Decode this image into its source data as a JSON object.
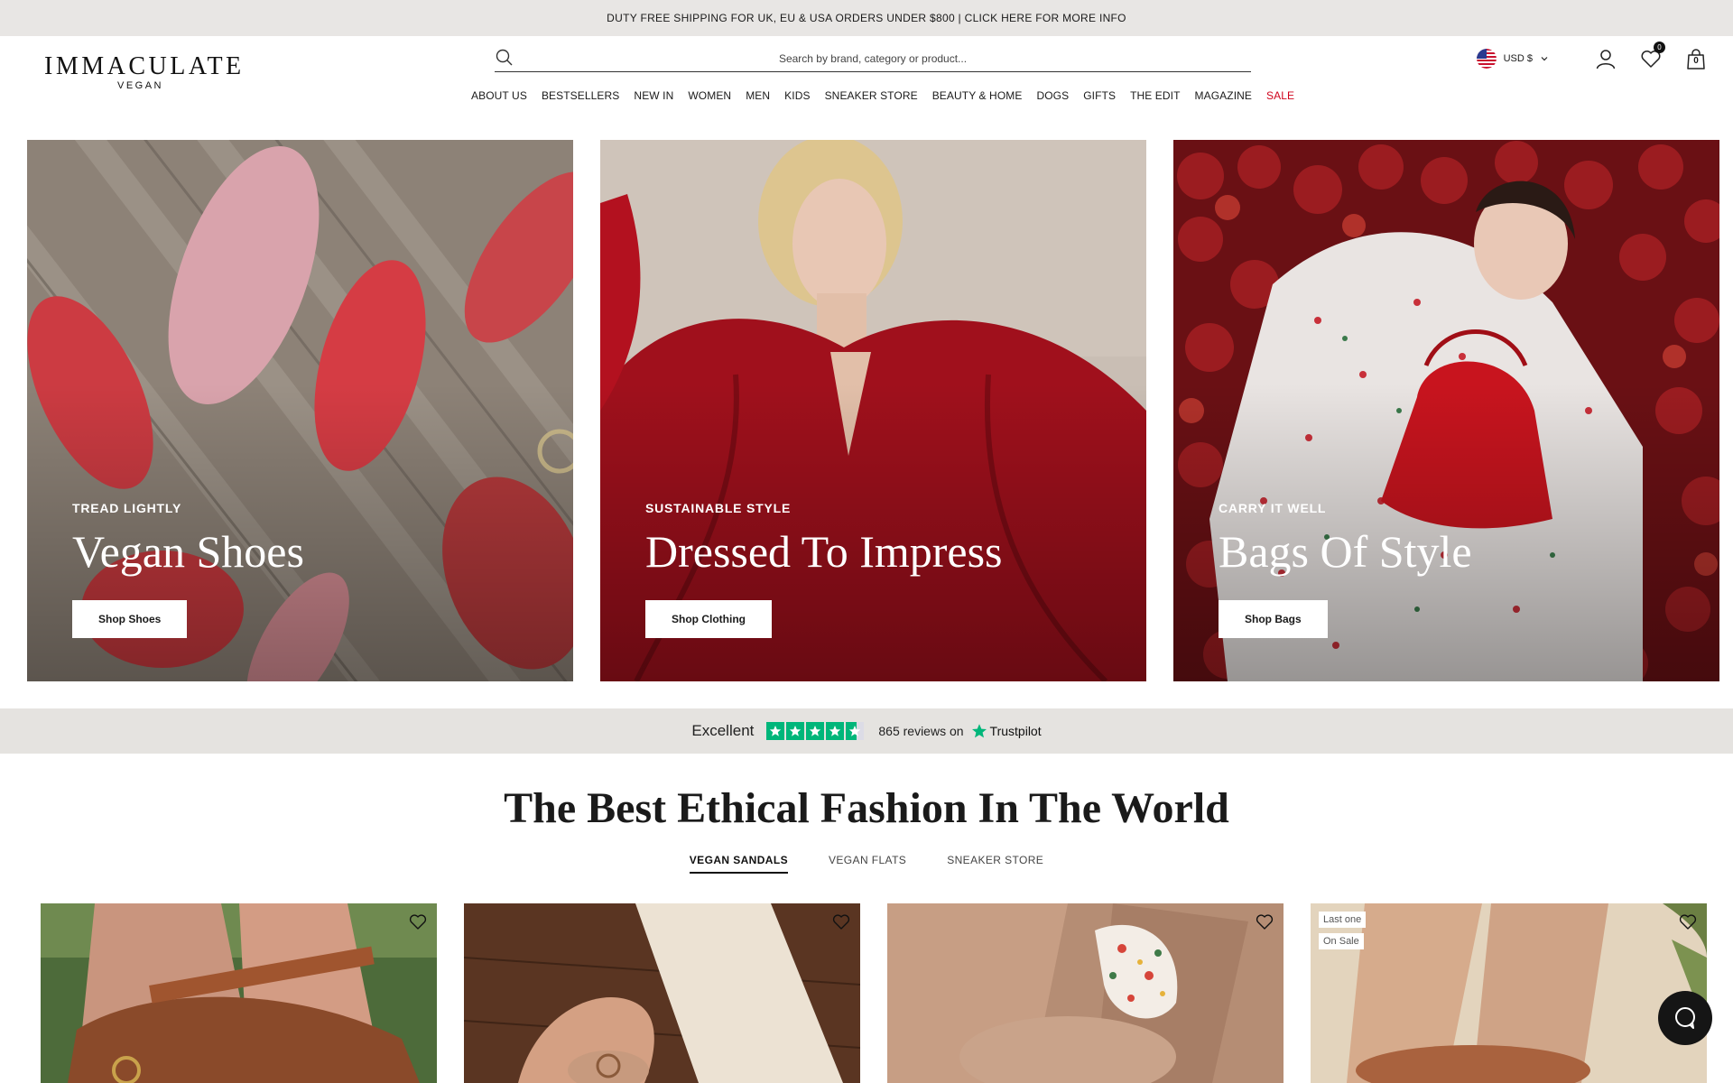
{
  "announcement": "DUTY FREE SHIPPING FOR UK, EU & USA ORDERS UNDER $800 | CLICK HERE FOR MORE INFO",
  "logo": {
    "main": "IMMACULATE",
    "sub": "VEGAN"
  },
  "search": {
    "placeholder": "Search by brand, category or product..."
  },
  "nav": [
    "ABOUT US",
    "BESTSELLERS",
    "NEW IN",
    "WOMEN",
    "MEN",
    "KIDS",
    "SNEAKER STORE",
    "BEAUTY & HOME",
    "DOGS",
    "GIFTS",
    "THE EDIT",
    "MAGAZINE",
    "SALE"
  ],
  "header_tools": {
    "currency": "USD $",
    "wishlist_count": "0",
    "cart_count": "0"
  },
  "hero_tiles": [
    {
      "eyebrow": "TREAD LIGHTLY",
      "title": "Vegan Shoes",
      "button": "Shop Shoes"
    },
    {
      "eyebrow": "SUSTAINABLE STYLE",
      "title": "Dressed To Impress",
      "button": "Shop Clothing"
    },
    {
      "eyebrow": "CARRY IT WELL",
      "title": "Bags Of Style",
      "button": "Shop Bags"
    }
  ],
  "trustpilot": {
    "rating_word": "Excellent",
    "reviews": "865 reviews on",
    "brand": "Trustpilot",
    "stars": 4.5
  },
  "section": {
    "title": "The Best Ethical Fashion In The World",
    "tabs": [
      "VEGAN SANDALS",
      "VEGAN FLATS",
      "SNEAKER STORE"
    ],
    "active_tab": "VEGAN SANDALS"
  },
  "products": [
    {
      "tags": []
    },
    {
      "tags": []
    },
    {
      "tags": []
    },
    {
      "tags": [
        "Last one",
        "On Sale"
      ]
    }
  ],
  "colors": {
    "sale": "#d0021b",
    "trustpilot_green": "#00b67a",
    "announcement_bg": "#e8e6e4"
  }
}
